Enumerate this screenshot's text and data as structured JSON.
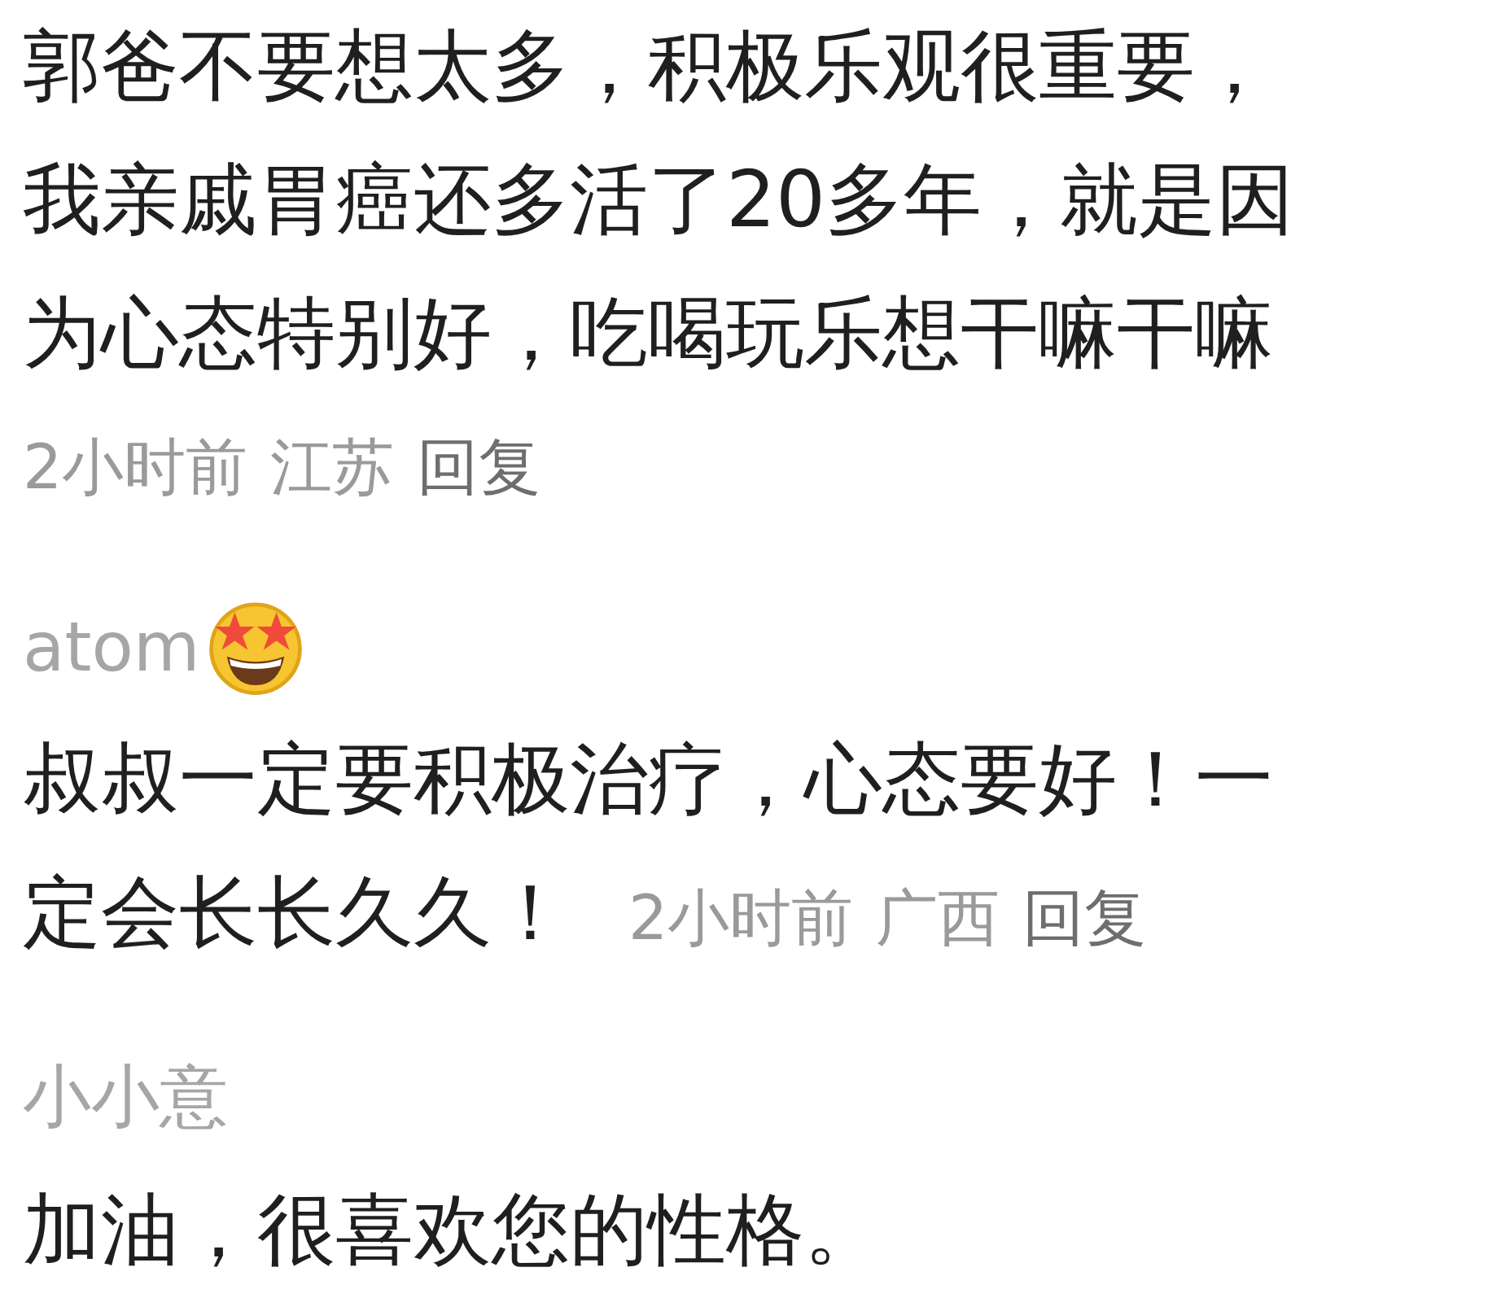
{
  "comments": [
    {
      "text_lines": [
        "郭爸不要想太多，积极乐观很重要，",
        "我亲戚胃癌还多活了20多年，就是因",
        "为心态特别好，吃喝玩乐想干嘛干嘛"
      ],
      "meta": {
        "time": "2小时前",
        "location": "江苏",
        "reply": "回复"
      }
    },
    {
      "username": "atom",
      "has_emoji": true,
      "text_lines": [
        "叔叔一定要积极治疗，心态要好！一",
        "定会长长久久！"
      ],
      "meta": {
        "time": "2小时前",
        "location": "广西",
        "reply": "回复"
      }
    },
    {
      "username": "小小意",
      "text_lines": [
        "加油，很喜欢您的性格。"
      ]
    }
  ]
}
